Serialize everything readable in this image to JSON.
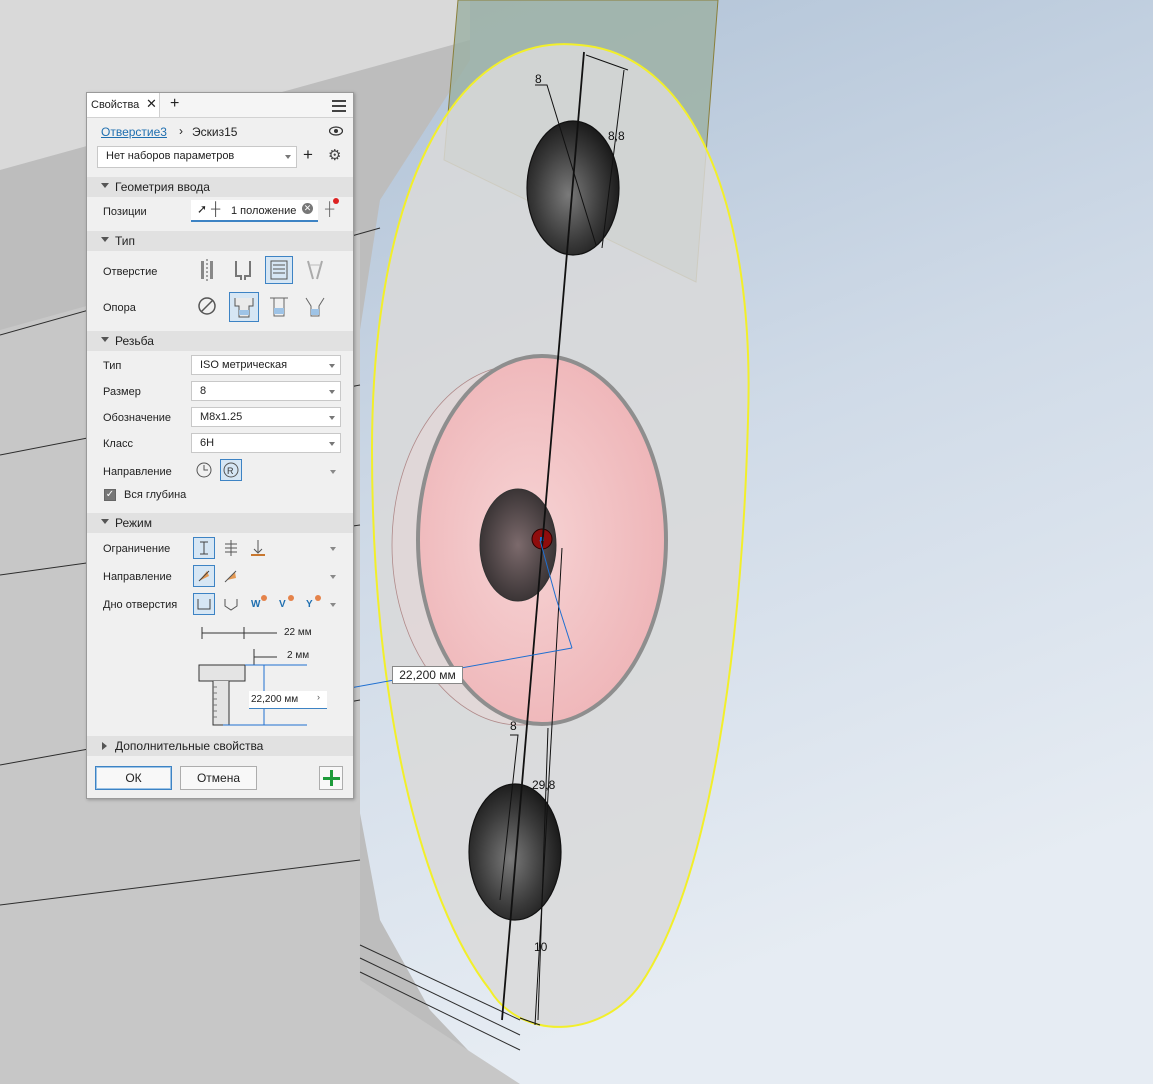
{
  "panel": {
    "tab_title": "Свойства",
    "breadcrumb": {
      "feature": "Отверстие3",
      "sketch": "Эскиз15"
    },
    "preset": "Нет наборов параметров",
    "sections": {
      "input_geometry": {
        "title": "Геометрия ввода",
        "positions_label": "Позиции",
        "positions_value": "1 положение"
      },
      "type": {
        "title": "Тип",
        "hole_label": "Отверстие",
        "seat_label": "Опора"
      },
      "thread": {
        "title": "Резьба",
        "type_label": "Тип",
        "type_value": "ISO метрическая",
        "size_label": "Размер",
        "size_value": "8",
        "designation_label": "Обозначение",
        "designation_value": "M8x1.25",
        "class_label": "Класс",
        "class_value": "6H",
        "direction_label": "Направление",
        "full_depth_label": "Вся глубина",
        "full_depth_checked": true
      },
      "mode": {
        "title": "Режим",
        "limit_label": "Ограничение",
        "direction_label": "Направление",
        "bottom_label": "Дно отверстия"
      },
      "extra": {
        "title": "Дополнительные свойства"
      }
    },
    "diagram": {
      "width_value": "22 мм",
      "thread_value": "2 мм",
      "depth_value": "22,200 мм"
    },
    "buttons": {
      "ok": "ОК",
      "cancel": "Отмена"
    }
  },
  "viewport": {
    "dim_top_left": "8",
    "dim_top_right": "8,8",
    "dim_bottom_left": "8",
    "dim_bottom_mid": "29,8",
    "dim_bottom": "10",
    "depth_label": "22,200 мм"
  },
  "colors": {
    "background_top": "#a9bdd3",
    "background_bottom": "#e4ebf3",
    "selection_yellow": "#f2ef2a",
    "hole_pink": "#f2c2c4",
    "accent_blue": "#2f7bd0",
    "add_green": "#1d9b3a"
  }
}
